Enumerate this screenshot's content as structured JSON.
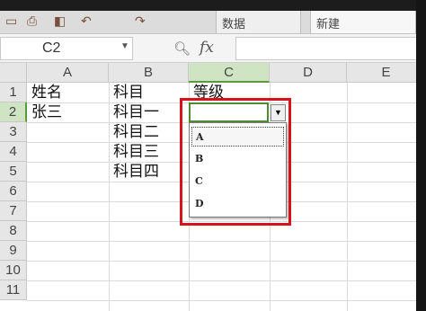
{
  "toolbar": {
    "tabs": [
      "数据",
      "新建"
    ]
  },
  "formula_bar": {
    "name_box": "C2",
    "formula": ""
  },
  "grid": {
    "columns": [
      "A",
      "B",
      "C",
      "D",
      "E"
    ],
    "rows": [
      "1",
      "2",
      "3",
      "4",
      "5",
      "6",
      "7",
      "8",
      "9",
      "10",
      "11"
    ],
    "cells": {
      "A1": "姓名",
      "B1": "科目",
      "C1": "等级",
      "A2": "张三",
      "B2": "科目一",
      "B3": "科目二",
      "B4": "科目三",
      "B5": "科目四"
    }
  },
  "dropdown": {
    "options": [
      "A",
      "B",
      "C",
      "D"
    ]
  },
  "colors": {
    "selection_green": "#5a9a3e",
    "highlight_red": "#d8121b"
  }
}
